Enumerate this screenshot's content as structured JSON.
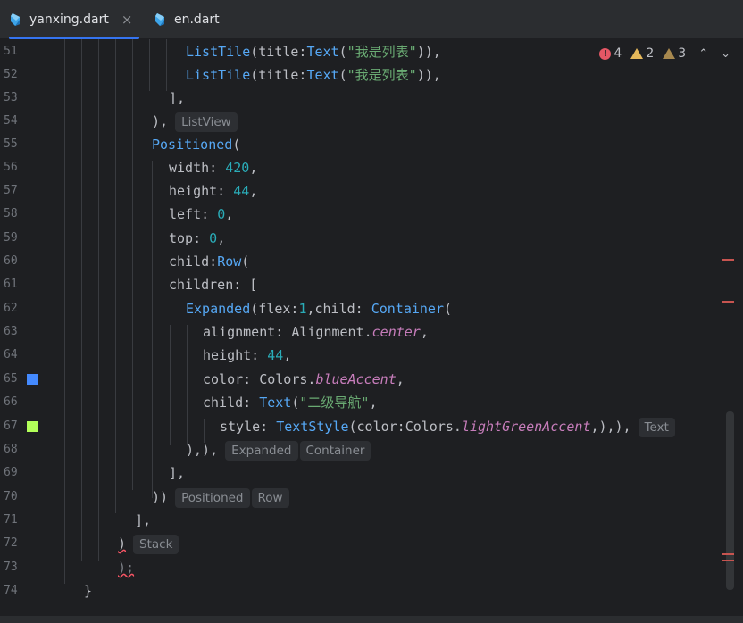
{
  "tabs": [
    {
      "label": "yanxing.dart",
      "close": "×",
      "active": true
    },
    {
      "label": "en.dart",
      "active": false
    }
  ],
  "inspection": {
    "errors": "4",
    "warnings": "2",
    "weak_warnings": "3",
    "up": "⌃",
    "down": "⌄"
  },
  "line_numbers": [
    "51",
    "52",
    "53",
    "54",
    "55",
    "56",
    "57",
    "58",
    "59",
    "60",
    "61",
    "62",
    "63",
    "64",
    "65",
    "66",
    "67",
    "68",
    "69",
    "70",
    "71",
    "72",
    "73",
    "74"
  ],
  "swatch_colors": {
    "blueAccent": "#448aff",
    "lightGreenAccent": "#b2ff59"
  },
  "code": {
    "l51": {
      "a": "ListTile",
      "b": "(title:",
      "c": "Text",
      "d": "(",
      "e": "\"我是列表\"",
      "f": ")),"
    },
    "l52": {
      "a": "ListTile",
      "b": "(title:",
      "c": "Text",
      "d": "(",
      "e": "\"我是列表\"",
      "f": ")),"
    },
    "l53": "],",
    "l54": "),",
    "l54_hint": "ListView",
    "l55": {
      "a": "Positioned",
      "b": "("
    },
    "l56": {
      "a": "width: ",
      "b": "420",
      "c": ","
    },
    "l57": {
      "a": "height: ",
      "b": "44",
      "c": ","
    },
    "l58": {
      "a": "left: ",
      "b": "0",
      "c": ","
    },
    "l59": {
      "a": "top: ",
      "b": "0",
      "c": ","
    },
    "l60": {
      "a": "child:",
      "b": "Row",
      "c": "("
    },
    "l61": "children: [",
    "l62": {
      "a": "Expanded",
      "b": "(flex:",
      "c": "1",
      "d": ",child: ",
      "e": "Container",
      "f": "("
    },
    "l63": {
      "a": "alignment: Alignment.",
      "b": "center",
      "c": ","
    },
    "l64": {
      "a": "height: ",
      "b": "44",
      "c": ","
    },
    "l65": {
      "a": "color: Colors.",
      "b": "blueAccent",
      "c": ","
    },
    "l66": {
      "a": "child: ",
      "b": "Text",
      "c": "(",
      "d": "\"二级导航\"",
      "e": ","
    },
    "l67": {
      "a": "style: ",
      "b": "TextStyle",
      "c": "(color:Colors.",
      "d": "lightGreenAccent",
      "e": ",),),"
    },
    "l67_hint": "Text",
    "l68": "),),",
    "l68_hints": [
      "Expanded",
      "Container"
    ],
    "l69": "],",
    "l70": "))",
    "l70_hints": [
      "Positioned",
      "Row"
    ],
    "l71": "],",
    "l72": ")",
    "l72_hint": "Stack",
    "l73": ");",
    "l74": "}"
  }
}
